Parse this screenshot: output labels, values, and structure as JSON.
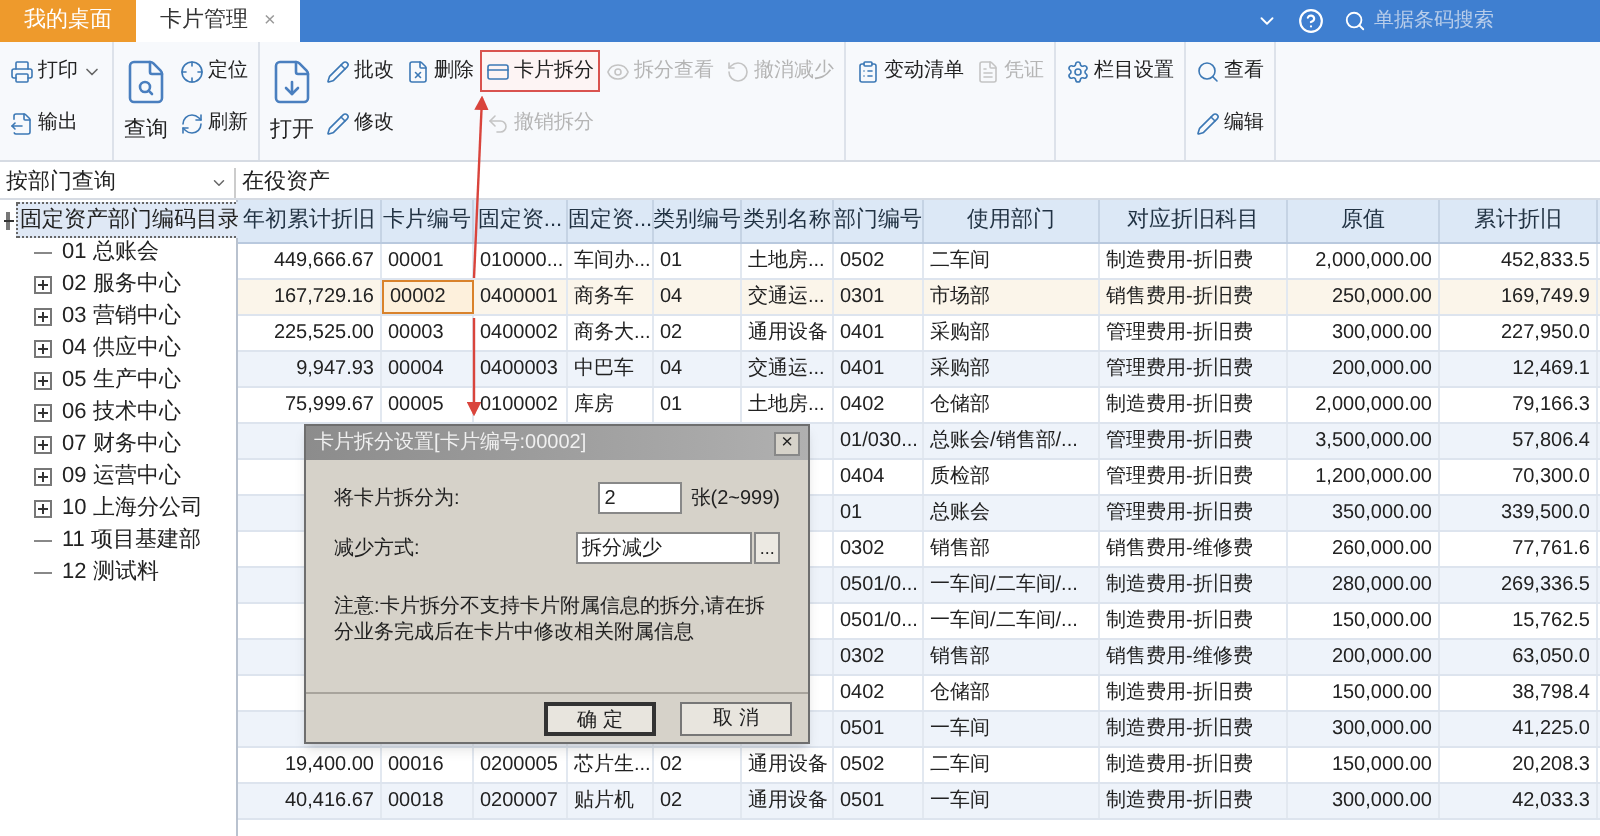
{
  "top_bar": {
    "tabs": [
      {
        "label": "我的桌面",
        "selected": false,
        "closable": false
      },
      {
        "label": "卡片管理",
        "selected": true,
        "closable": true
      }
    ],
    "close_mark": "×",
    "search": {
      "placeholder": "单据条码搜索"
    }
  },
  "toolbar": {
    "groups": [
      {
        "columns": [
          [
            {
              "label": "打印",
              "dropdown": true,
              "disabled": false,
              "highlighted": false
            },
            {
              "label": "输出",
              "dropdown": false,
              "disabled": false,
              "highlighted": false
            }
          ]
        ]
      },
      {
        "large": {
          "label": "查询",
          "disabled": false
        },
        "columns": [
          [
            {
              "label": "定位",
              "dropdown": false,
              "disabled": false,
              "highlighted": false
            },
            {
              "label": "刷新",
              "dropdown": false,
              "disabled": false,
              "highlighted": false
            }
          ]
        ]
      },
      {
        "large": {
          "label": "打开",
          "disabled": false
        },
        "columns": [
          [
            {
              "label": "批改",
              "dropdown": false,
              "disabled": false,
              "highlighted": false
            },
            {
              "label": "修改",
              "dropdown": false,
              "disabled": false,
              "highlighted": false
            }
          ],
          [
            {
              "label": "删除",
              "dropdown": false,
              "disabled": false,
              "highlighted": false
            }
          ],
          [
            {
              "label": "卡片拆分",
              "dropdown": false,
              "disabled": false,
              "highlighted": true
            },
            {
              "label": "撤销拆分",
              "dropdown": false,
              "disabled": true,
              "highlighted": false
            }
          ],
          [
            {
              "label": "拆分查看",
              "dropdown": false,
              "disabled": true,
              "highlighted": false
            }
          ],
          [
            {
              "label": "撤消减少",
              "dropdown": false,
              "disabled": true,
              "highlighted": false
            }
          ]
        ]
      },
      {
        "columns": [
          [
            {
              "label": "变动清单",
              "dropdown": false,
              "disabled": false,
              "highlighted": false
            }
          ],
          [
            {
              "label": "凭证",
              "dropdown": false,
              "disabled": true,
              "highlighted": false
            }
          ]
        ]
      },
      {
        "columns": [
          [
            {
              "label": "栏目设置",
              "dropdown": false,
              "disabled": false,
              "highlighted": false
            }
          ]
        ]
      },
      {
        "columns": [
          [
            {
              "label": "查看",
              "dropdown": false,
              "disabled": false,
              "highlighted": false
            },
            {
              "label": "编辑",
              "dropdown": false,
              "disabled": false,
              "highlighted": false
            }
          ]
        ]
      }
    ]
  },
  "filter": {
    "query_mode": "按部门查询",
    "scope": "在役资产"
  },
  "tree": [
    {
      "label": "固定资产部门编码目录",
      "kind": "folder",
      "expanded": true,
      "selected": true,
      "children": [
        {
          "label": "01 总账会",
          "kind": "leaf",
          "expanded": false,
          "selected": false
        },
        {
          "label": "02 服务中心",
          "kind": "folder",
          "expanded": false,
          "selected": false
        },
        {
          "label": "03 营销中心",
          "kind": "folder",
          "expanded": false,
          "selected": false
        },
        {
          "label": "04 供应中心",
          "kind": "folder",
          "expanded": false,
          "selected": false
        },
        {
          "label": "05 生产中心",
          "kind": "folder",
          "expanded": false,
          "selected": false
        },
        {
          "label": "06 技术中心",
          "kind": "folder",
          "expanded": false,
          "selected": false
        },
        {
          "label": "07 财务中心",
          "kind": "folder",
          "expanded": false,
          "selected": false
        },
        {
          "label": "09 运营中心",
          "kind": "folder",
          "expanded": false,
          "selected": false
        },
        {
          "label": "10 上海分公司",
          "kind": "folder",
          "expanded": false,
          "selected": false
        },
        {
          "label": "11 项目基建部",
          "kind": "leaf",
          "expanded": false,
          "selected": false
        },
        {
          "label": "12 测试料",
          "kind": "leaf",
          "expanded": false,
          "selected": false
        }
      ]
    }
  ],
  "table": {
    "columns": [
      "年初累计折旧",
      "卡片编号",
      "固定资...",
      "固定资...",
      "类别编号",
      "类别名称",
      "部门编号",
      "使用部门",
      "对应折旧科目",
      "原值",
      "累计折旧"
    ],
    "rows": [
      {
        "selected": false,
        "cells": [
          "449,666.67",
          "00001",
          "010000...",
          "车间办...",
          "01",
          "土地房...",
          "0502",
          "二车间",
          "制造费用-折旧费",
          "2,000,000.00",
          "452,833.5"
        ]
      },
      {
        "selected": true,
        "cells": [
          "167,729.16",
          "00002",
          "0400001",
          "商务车",
          "04",
          "交通运...",
          "0301",
          "市场部",
          "销售费用-折旧费",
          "250,000.00",
          "169,749.9"
        ]
      },
      {
        "selected": false,
        "cells": [
          "225,525.00",
          "00003",
          "0400002",
          "商务大...",
          "02",
          "通用设备",
          "0401",
          "采购部",
          "管理费用-折旧费",
          "300,000.00",
          "227,950.0"
        ]
      },
      {
        "selected": false,
        "cells": [
          "9,947.93",
          "00004",
          "0400003",
          "中巴车",
          "04",
          "交通运...",
          "0401",
          "采购部",
          "管理费用-折旧费",
          "200,000.00",
          "12,469.1"
        ]
      },
      {
        "selected": false,
        "cells": [
          "75,999.67",
          "00005",
          "0100002",
          "库房",
          "01",
          "土地房...",
          "0402",
          "仓储部",
          "制造费用-折旧费",
          "2,000,000.00",
          "79,166.3"
        ]
      },
      {
        "selected": false,
        "covered": true,
        "cells": [
          "01/030...",
          "总账会/销售部/...",
          "管理费用-折旧费",
          "3,500,000.00",
          "57,806.4"
        ]
      },
      {
        "selected": false,
        "covered": true,
        "cells": [
          "0404",
          "质检部",
          "管理费用-折旧费",
          "1,200,000.00",
          "70,300.0"
        ]
      },
      {
        "selected": false,
        "covered": true,
        "cells": [
          "01",
          "总账会",
          "管理费用-折旧费",
          "350,000.00",
          "339,500.0"
        ]
      },
      {
        "selected": false,
        "covered": true,
        "cells": [
          "0302",
          "销售部",
          "销售费用-维修费",
          "260,000.00",
          "77,761.6"
        ]
      },
      {
        "selected": false,
        "covered": true,
        "cells": [
          "0501/0...",
          "一车间/二车间/...",
          "制造费用-折旧费",
          "280,000.00",
          "269,336.5"
        ]
      },
      {
        "selected": false,
        "covered": true,
        "cells": [
          "0501/0...",
          "一车间/二车间/...",
          "制造费用-折旧费",
          "150,000.00",
          "15,762.5"
        ]
      },
      {
        "selected": false,
        "covered": true,
        "cells": [
          "0302",
          "销售部",
          "销售费用-维修费",
          "200,000.00",
          "63,050.0"
        ]
      },
      {
        "selected": false,
        "covered": true,
        "cells": [
          "0402",
          "仓储部",
          "制造费用-折旧费",
          "150,000.00",
          "38,798.4"
        ]
      },
      {
        "selected": false,
        "covered": true,
        "cells": [
          "0501",
          "一车间",
          "制造费用-折旧费",
          "300,000.00",
          "41,225.0"
        ]
      },
      {
        "selected": false,
        "cells": [
          "19,400.00",
          "00016",
          "0200005",
          "芯片生...",
          "02",
          "通用设备",
          "0502",
          "二车间",
          "制造费用-折旧费",
          "150,000.00",
          "20,208.3"
        ]
      },
      {
        "selected": false,
        "cells": [
          "40,416.67",
          "00018",
          "0200007",
          "贴片机",
          "02",
          "通用设备",
          "0501",
          "一车间",
          "制造费用-折旧费",
          "300,000.00",
          "42,033.3"
        ]
      }
    ]
  },
  "dialog": {
    "title": "卡片拆分设置[卡片编号:00002]",
    "close": "×",
    "split_label": "将卡片拆分为:",
    "split_value": "2",
    "split_unit": "张(2~999)",
    "method_label": "减少方式:",
    "method_value": "拆分减少",
    "browse": "...",
    "note": "注意:卡片拆分不支持卡片附属信息的拆分,请在拆分业务完成后在卡片中修改相关附属信息",
    "buttons": [
      "确 定",
      "取 消"
    ]
  }
}
